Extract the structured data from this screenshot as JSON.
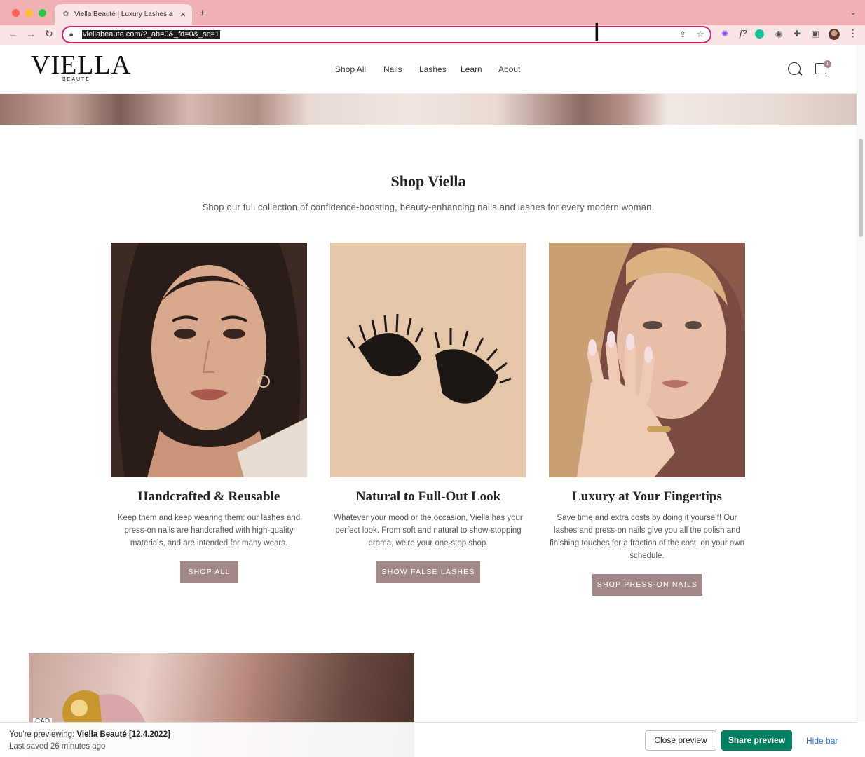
{
  "browser": {
    "tab_title": "Viella Beauté | Luxury Lashes a",
    "url": "viellabeaute.com/?_ab=0&_fd=0&_sc=1",
    "new_tab": "+",
    "close_tab": "×"
  },
  "header": {
    "logo_main": "VIELLA",
    "logo_sub": "BEAUTÉ",
    "nav": [
      "Shop All",
      "Nails",
      "Lashes",
      "Learn",
      "About"
    ],
    "cart_count": "1"
  },
  "section": {
    "title": "Shop Viella",
    "subtitle": "Shop our full collection of confidence-boosting, beauty-enhancing nails and lashes for every modern woman."
  },
  "cards": [
    {
      "heading": "Handcrafted & Reusable",
      "text": "Keep them and keep wearing them: our lashes and press-on nails are handcrafted with high-quality materials, and are intended for many wears.",
      "button": "SHOP ALL"
    },
    {
      "heading": "Natural to Full-Out Look",
      "text": "Whatever your mood or the occasion, Viella has your perfect look. From soft and natural to show-stopping drama, we're your one-stop shop.",
      "button": "SHOW FALSE LASHES"
    },
    {
      "heading": "Luxury at Your Fingertips",
      "text": "Save time and extra costs by doing it yourself! Our lashes and press-on nails give you all the polish and finishing touches for a fraction of the cost, on your own schedule.",
      "button": "SHOP PRESS-ON NAILS"
    }
  ],
  "currency": "CAD",
  "preview_bar": {
    "prefix": "You're previewing:",
    "theme": "Viella Beauté [12.4.2022]",
    "saved": "Last saved 26 minutes ago",
    "close_label": "Close preview",
    "share_label": "Share preview",
    "hide_label": "Hide bar"
  },
  "colors": {
    "accent_button": "#a18886",
    "share_green": "#008060",
    "tabbar": "#f1b0b3"
  }
}
